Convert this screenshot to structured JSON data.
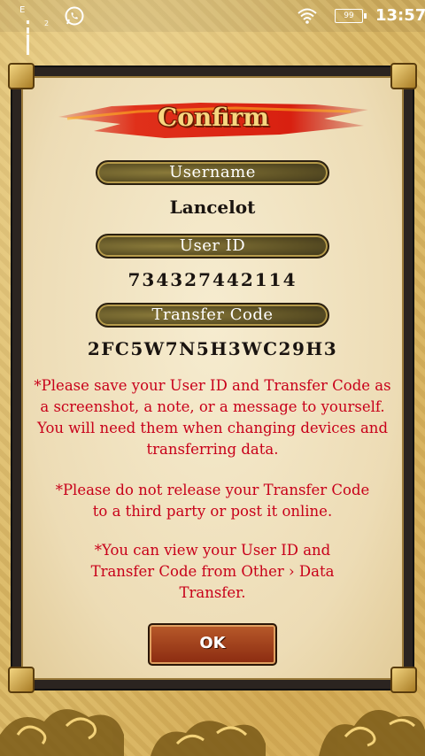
{
  "status_bar": {
    "signal_label": "E",
    "sim_label": "2",
    "battery": "99",
    "time": "13:57",
    "whatsapp_icon": "whatsapp-icon",
    "wifi_icon": "wifi-icon"
  },
  "dialog": {
    "title": "Confirm",
    "username_label": "Username",
    "username_value": "Lancelot",
    "userid_label": "User ID",
    "userid_value": "734327442114",
    "transfer_label": "Transfer Code",
    "transfer_value": "2FC5W7N5H3WC29H3",
    "note_1": "*Please save your User ID and Transfer Code as a screenshot, a note, or a message to yourself. You will need them when changing devices and transferring data.",
    "note_2": "*Please do not release your Transfer Code to a third party or post it online.",
    "note_3": "*You can view your User ID and Transfer Code from Other › Data Transfer.",
    "ok_label": "OK"
  },
  "colors": {
    "note_text": "#c8001a",
    "title_text": "#f7d680",
    "pill_bg": "#5c5024"
  }
}
